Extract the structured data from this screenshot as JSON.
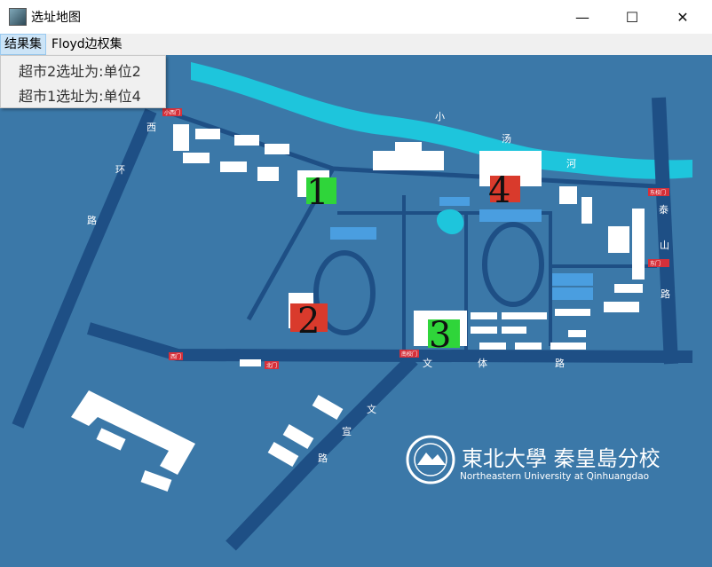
{
  "window": {
    "title": "选址地图",
    "minimize_glyph": "—",
    "maximize_glyph": "☐",
    "close_glyph": "✕"
  },
  "menu": {
    "items": [
      {
        "label": "结果集"
      },
      {
        "label": "Floyd边权集"
      }
    ]
  },
  "popup": {
    "items": [
      {
        "label": "超市2选址为:单位2"
      },
      {
        "label": "超市1选址为:单位4"
      }
    ]
  },
  "map": {
    "markers": [
      {
        "label": "1",
        "color": "green"
      },
      {
        "label": "2",
        "color": "red"
      },
      {
        "label": "3",
        "color": "green"
      },
      {
        "label": "4",
        "color": "red"
      }
    ],
    "roads": {
      "west": [
        "西",
        "环",
        "路"
      ],
      "river": [
        "小",
        "汤",
        "河"
      ],
      "east": [
        "泰",
        "山",
        "路"
      ],
      "south": [
        "文",
        "体",
        "路"
      ],
      "diag": [
        "文",
        "宣",
        "路"
      ]
    },
    "gates": [
      "小西门",
      "东校门",
      "东门",
      "西门",
      "北门",
      "南校门"
    ],
    "logo": {
      "cn": "東北大學 秦皇島分校",
      "en": "Northeastern University at Qinhuangdao"
    },
    "colors": {
      "water": "#1ec5dc",
      "road": "#1e4f85",
      "green_marker": "#2fd53a",
      "red_marker": "#d93a2c"
    }
  }
}
